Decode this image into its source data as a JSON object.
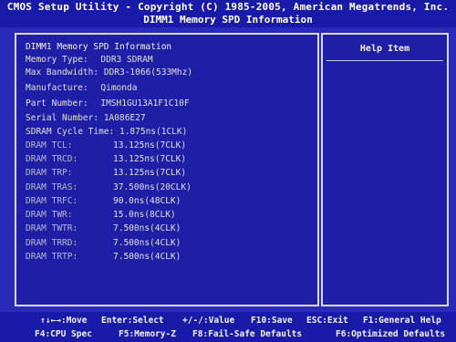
{
  "header": {
    "title": "CMOS Setup Utility - Copyright (C) 1985-2005, American Megatrends, Inc.",
    "subtitle": "DIMM1 Memory SPD Information"
  },
  "info": {
    "section_title": "DIMM1 Memory SPD Information",
    "memory_type_label": "Memory Type:",
    "memory_type_value": "DDR3 SDRAM",
    "max_bandwidth_label": "Max Bandwidth:",
    "max_bandwidth_value": "DDR3-1066(533Mhz)",
    "manufacture_label": "Manufacture:",
    "manufacture_value": "Qimonda",
    "part_number_label": "Part Number:",
    "part_number_value": "IMSH1GU13A1F1C10F",
    "serial_number_label": "Serial Number:",
    "serial_number_value": "1A086E27",
    "cycle_time_label": "SDRAM Cycle Time:",
    "cycle_time_value": "1.875ns(1CLK)"
  },
  "timings": [
    {
      "label": "DRAM TCL:",
      "value": "13.125ns(7CLK)"
    },
    {
      "label": "DRAM TRCD:",
      "value": "13.125ns(7CLK)"
    },
    {
      "label": "DRAM TRP:",
      "value": "13.125ns(7CLK)"
    },
    {
      "label": "DRAM TRAS:",
      "value": "37.500ns(20CLK)"
    },
    {
      "label": "DRAM TRFC:",
      "value": "90.0ns(48CLK)"
    },
    {
      "label": "DRAM TWR:",
      "value": "15.0ns(8CLK)"
    },
    {
      "label": "DRAM TWTR:",
      "value": "7.500ns(4CLK)"
    },
    {
      "label": "DRAM TRRD:",
      "value": "7.500ns(4CLK)"
    },
    {
      "label": "DRAM TRTP:",
      "value": "7.500ns(4CLK)"
    }
  ],
  "help": {
    "title": "Help Item"
  },
  "footer": {
    "move": "↑↓←→:Move",
    "select": "Enter:Select",
    "value": "+/-/:Value",
    "save": "F10:Save",
    "exit": "ESC:Exit",
    "general_help": "F1:General Help",
    "cpu_spec": "F4:CPU Spec",
    "memory_z": "F5:Memory-Z",
    "fail_safe": "F8:Fail-Safe Defaults",
    "optimized": "F6:Optimized Defaults"
  }
}
